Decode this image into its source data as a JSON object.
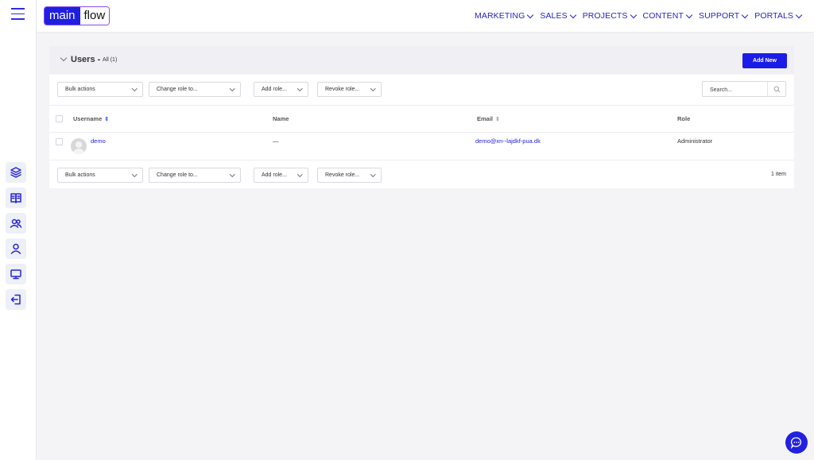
{
  "brand": {
    "part1": "main",
    "part2": "flow"
  },
  "nav": [
    {
      "label": "MARKETING"
    },
    {
      "label": "SALES"
    },
    {
      "label": "PROJECTS"
    },
    {
      "label": "CONTENT"
    },
    {
      "label": "SUPPORT"
    },
    {
      "label": "PORTALS"
    }
  ],
  "rail_icons": [
    "layers-icon",
    "book-icon",
    "users-icon",
    "user-icon",
    "monitor-icon",
    "logout-icon"
  ],
  "page": {
    "title": "Users -",
    "filter_label": "All (1)",
    "add_new_label": "Add New"
  },
  "filters": {
    "bulk_actions": "Bulk actions",
    "change_role": "Change role to...",
    "add_role": "Add role...",
    "revoke_role": "Revoke role...",
    "search_placeholder": "Search...",
    "items_count": "1 item"
  },
  "table": {
    "columns": {
      "username": "Username",
      "name": "Name",
      "email": "Email",
      "role": "Role"
    },
    "rows": [
      {
        "username": "demo",
        "name": "—",
        "email": "demo@xn--lajdkf-pua.dk",
        "role": "Administrator"
      }
    ]
  },
  "colors": {
    "accent": "#1f1fe0",
    "link": "#2323d6",
    "background": "#f4f4f7"
  }
}
